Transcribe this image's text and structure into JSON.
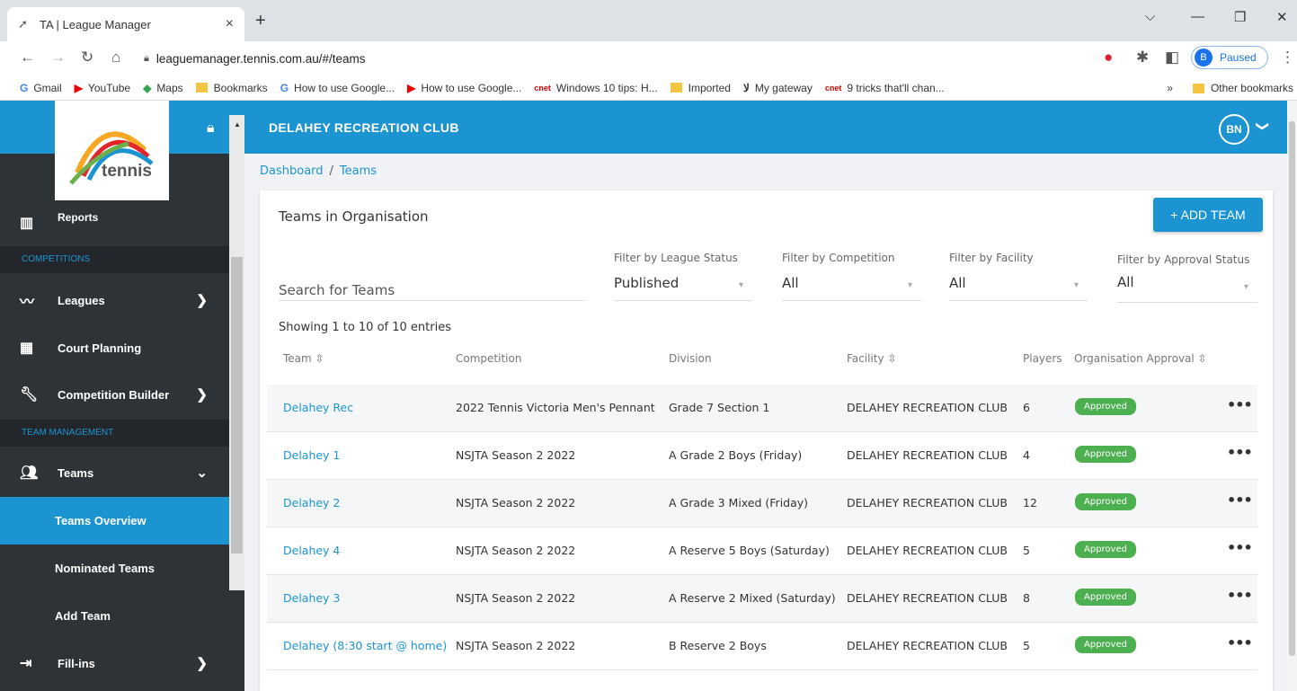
{
  "browser": {
    "tab_title": "TA | League Manager",
    "tab_close": "×",
    "new_tab": "+",
    "url": "leaguemanager.tennis.com.au/#/teams",
    "profile_initial": "B",
    "profile_status": "Paused",
    "bookmarks": [
      {
        "label": "Gmail",
        "icon": "gmail-icon"
      },
      {
        "label": "YouTube",
        "icon": "youtube-icon"
      },
      {
        "label": "Maps",
        "icon": "maps-icon"
      },
      {
        "label": "Bookmarks",
        "icon": "folder-icon"
      },
      {
        "label": "How to use Google...",
        "icon": "google-icon"
      },
      {
        "label": "How to use Google...",
        "icon": "youtube-icon"
      },
      {
        "label": "Windows 10 tips: H...",
        "icon": "cnet-icon"
      },
      {
        "label": "Imported",
        "icon": "folder-icon"
      },
      {
        "label": "My gateway",
        "icon": "gateway-icon"
      },
      {
        "label": "9 tricks that'll chan...",
        "icon": "cnet-icon"
      }
    ],
    "bookmarks_overflow": "»",
    "other_bookmarks": "Other bookmarks"
  },
  "sidebar": {
    "logo_text": "tennis",
    "reports_label": "Reports",
    "sections": {
      "competitions": "COMPETITIONS",
      "team_management": "TEAM MANAGEMENT"
    },
    "items": {
      "leagues": "Leagues",
      "court_planning": "Court Planning",
      "competition_builder": "Competition Builder",
      "teams": "Teams",
      "teams_overview": "Teams Overview",
      "nominated_teams": "Nominated Teams",
      "add_team": "Add Team",
      "fill_ins": "Fill-ins"
    }
  },
  "header": {
    "club_name": "DELAHEY RECREATION CLUB",
    "user_initials": "BN"
  },
  "breadcrumb": {
    "dashboard": "Dashboard",
    "separator": "/",
    "current": "Teams"
  },
  "card": {
    "title": "Teams in Organisation",
    "add_button": "+ ADD TEAM",
    "search_placeholder": "Search for Teams",
    "filters": {
      "league_status": {
        "label": "Filter by League Status",
        "value": "Published"
      },
      "competition": {
        "label": "Filter by Competition",
        "value": "All"
      },
      "facility": {
        "label": "Filter by Facility",
        "value": "All"
      },
      "approval_status": {
        "label": "Filter by Approval Status",
        "value": "All"
      }
    },
    "showing": "Showing 1 to 10 of 10 entries",
    "columns": [
      "Team",
      "Competition",
      "Division",
      "Facility",
      "Players",
      "Organisation Approval"
    ],
    "rows": [
      {
        "team": "Delahey Rec",
        "competition": "2022 Tennis Victoria Men's Pennant",
        "division": "Grade 7 Section 1",
        "facility": "DELAHEY RECREATION CLUB",
        "players": "6",
        "approval": "Approved"
      },
      {
        "team": "Delahey 1",
        "competition": "NSJTA Season 2 2022",
        "division": "A Grade 2 Boys (Friday)",
        "facility": "DELAHEY RECREATION CLUB",
        "players": "4",
        "approval": "Approved"
      },
      {
        "team": "Delahey 2",
        "competition": "NSJTA Season 2 2022",
        "division": "A Grade 3 Mixed (Friday)",
        "facility": "DELAHEY RECREATION CLUB",
        "players": "12",
        "approval": "Approved"
      },
      {
        "team": "Delahey 4",
        "competition": "NSJTA Season 2 2022",
        "division": "A Reserve 5 Boys (Saturday)",
        "facility": "DELAHEY RECREATION CLUB",
        "players": "5",
        "approval": "Approved"
      },
      {
        "team": "Delahey 3",
        "competition": "NSJTA Season 2 2022",
        "division": "A Reserve 2 Mixed (Saturday)",
        "facility": "DELAHEY RECREATION CLUB",
        "players": "8",
        "approval": "Approved"
      },
      {
        "team": "Delahey (8:30 start @ home)",
        "competition": "NSJTA Season 2 2022",
        "division": "B Reserve 2 Boys",
        "facility": "DELAHEY RECREATION CLUB",
        "players": "5",
        "approval": "Approved"
      }
    ]
  },
  "colors": {
    "primary": "#1c94d2",
    "sidebar": "#2e3338",
    "approved": "#4caf50"
  }
}
